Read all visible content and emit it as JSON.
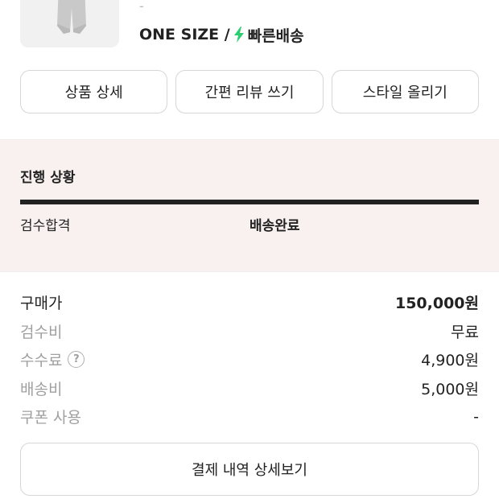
{
  "product": {
    "thumbnail_icon": "sweatpants-image",
    "dash": "-",
    "size": "ONE SIZE /",
    "delivery_icon": "lightning-bolt-icon",
    "delivery_label": "빠른배송",
    "accent_color": "#2ecc71"
  },
  "actions": {
    "detail": "상품 상세",
    "quick_review": "간편 리뷰 쓰기",
    "post_style": "스타일 올리기"
  },
  "progress": {
    "title": "진행 상황",
    "step_inspection": "검수합격",
    "step_delivered": "배송완료"
  },
  "pricing": {
    "purchase_label": "구매가",
    "purchase_value": "150,000원",
    "inspection_label": "검수비",
    "inspection_value": "무료",
    "fee_label": "수수료",
    "fee_help": "?",
    "fee_value": "4,900원",
    "shipping_label": "배송비",
    "shipping_value": "5,000원",
    "coupon_label": "쿠폰 사용",
    "coupon_value": "-"
  },
  "payment_detail_button": "결제 내역 상세보기"
}
